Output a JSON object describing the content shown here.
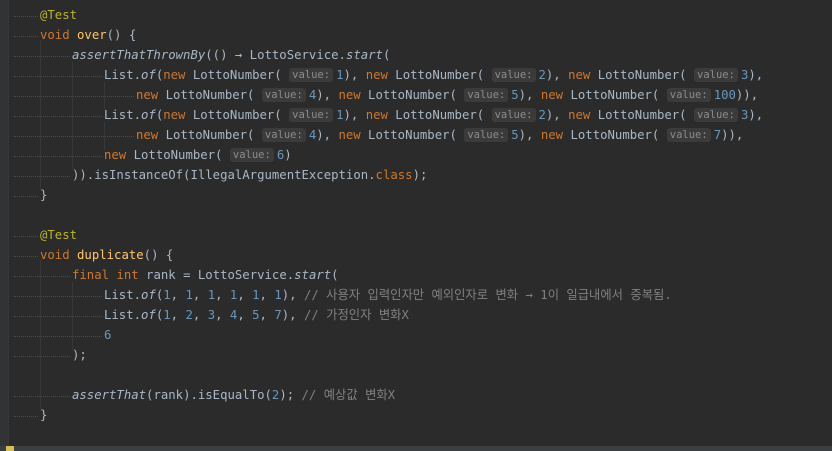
{
  "editor": {
    "lines": [
      [
        {
          "t": "@Test",
          "c": "annotation"
        }
      ],
      [
        {
          "t": "void",
          "c": "keyword"
        },
        {
          "t": " ",
          "c": "plain"
        },
        {
          "t": "over",
          "c": "method"
        },
        {
          "t": "() {",
          "c": "plain"
        }
      ],
      [
        {
          "t": "assertThatThrownBy",
          "c": "static"
        },
        {
          "t": "(() → LottoService.",
          "c": "plain"
        },
        {
          "t": "start",
          "c": "static"
        },
        {
          "t": "(",
          "c": "plain"
        }
      ],
      [
        {
          "t": "List.",
          "c": "plain"
        },
        {
          "t": "of",
          "c": "static"
        },
        {
          "t": "(",
          "c": "plain"
        },
        {
          "t": "new",
          "c": "keyword"
        },
        {
          "t": " LottoNumber( ",
          "c": "plain"
        },
        {
          "h": "value:"
        },
        {
          "t": "1",
          "c": "number"
        },
        {
          "t": "), ",
          "c": "plain"
        },
        {
          "t": "new",
          "c": "keyword"
        },
        {
          "t": " LottoNumber( ",
          "c": "plain"
        },
        {
          "h": "value:"
        },
        {
          "t": "2",
          "c": "number"
        },
        {
          "t": "), ",
          "c": "plain"
        },
        {
          "t": "new",
          "c": "keyword"
        },
        {
          "t": " LottoNumber( ",
          "c": "plain"
        },
        {
          "h": "value:"
        },
        {
          "t": "3",
          "c": "number"
        },
        {
          "t": "),",
          "c": "plain"
        }
      ],
      [
        {
          "t": "new",
          "c": "keyword"
        },
        {
          "t": " LottoNumber( ",
          "c": "plain"
        },
        {
          "h": "value:"
        },
        {
          "t": "4",
          "c": "number"
        },
        {
          "t": "), ",
          "c": "plain"
        },
        {
          "t": "new",
          "c": "keyword"
        },
        {
          "t": " LottoNumber( ",
          "c": "plain"
        },
        {
          "h": "value:"
        },
        {
          "t": "5",
          "c": "number"
        },
        {
          "t": "), ",
          "c": "plain"
        },
        {
          "t": "new",
          "c": "keyword"
        },
        {
          "t": " LottoNumber( ",
          "c": "plain"
        },
        {
          "h": "value:"
        },
        {
          "t": "100",
          "c": "number"
        },
        {
          "t": ")),",
          "c": "plain"
        }
      ],
      [
        {
          "t": "List.",
          "c": "plain"
        },
        {
          "t": "of",
          "c": "static"
        },
        {
          "t": "(",
          "c": "plain"
        },
        {
          "t": "new",
          "c": "keyword"
        },
        {
          "t": " LottoNumber( ",
          "c": "plain"
        },
        {
          "h": "value:"
        },
        {
          "t": "1",
          "c": "number"
        },
        {
          "t": "), ",
          "c": "plain"
        },
        {
          "t": "new",
          "c": "keyword"
        },
        {
          "t": " LottoNumber( ",
          "c": "plain"
        },
        {
          "h": "value:"
        },
        {
          "t": "2",
          "c": "number"
        },
        {
          "t": "), ",
          "c": "plain"
        },
        {
          "t": "new",
          "c": "keyword"
        },
        {
          "t": " LottoNumber( ",
          "c": "plain"
        },
        {
          "h": "value:"
        },
        {
          "t": "3",
          "c": "number"
        },
        {
          "t": "),",
          "c": "plain"
        }
      ],
      [
        {
          "t": "new",
          "c": "keyword"
        },
        {
          "t": " LottoNumber( ",
          "c": "plain"
        },
        {
          "h": "value:"
        },
        {
          "t": "4",
          "c": "number"
        },
        {
          "t": "), ",
          "c": "plain"
        },
        {
          "t": "new",
          "c": "keyword"
        },
        {
          "t": " LottoNumber( ",
          "c": "plain"
        },
        {
          "h": "value:"
        },
        {
          "t": "5",
          "c": "number"
        },
        {
          "t": "), ",
          "c": "plain"
        },
        {
          "t": "new",
          "c": "keyword"
        },
        {
          "t": " LottoNumber( ",
          "c": "plain"
        },
        {
          "h": "value:"
        },
        {
          "t": "7",
          "c": "number"
        },
        {
          "t": ")),",
          "c": "plain"
        }
      ],
      [
        {
          "t": "new",
          "c": "keyword"
        },
        {
          "t": " LottoNumber( ",
          "c": "plain"
        },
        {
          "h": "value:"
        },
        {
          "t": "6",
          "c": "number"
        },
        {
          "t": ")",
          "c": "plain"
        }
      ],
      [
        {
          "t": ")).isInstanceOf(IllegalArgumentException.",
          "c": "plain"
        },
        {
          "t": "class",
          "c": "keyword"
        },
        {
          "t": ");",
          "c": "plain"
        }
      ],
      [
        {
          "t": "}",
          "c": "plain"
        }
      ],
      [],
      [
        {
          "t": "@Test",
          "c": "annotation"
        }
      ],
      [
        {
          "t": "void",
          "c": "keyword"
        },
        {
          "t": " ",
          "c": "plain"
        },
        {
          "t": "duplicate",
          "c": "method"
        },
        {
          "t": "() {",
          "c": "plain"
        }
      ],
      [
        {
          "t": "final",
          "c": "keyword"
        },
        {
          "t": " ",
          "c": "plain"
        },
        {
          "t": "int",
          "c": "keyword"
        },
        {
          "t": " rank = LottoService.",
          "c": "plain"
        },
        {
          "t": "start",
          "c": "static"
        },
        {
          "t": "(",
          "c": "plain"
        }
      ],
      [
        {
          "t": "List.",
          "c": "plain"
        },
        {
          "t": "of",
          "c": "static"
        },
        {
          "t": "(",
          "c": "plain"
        },
        {
          "t": "1",
          "c": "number"
        },
        {
          "t": ", ",
          "c": "plain"
        },
        {
          "t": "1",
          "c": "number"
        },
        {
          "t": ", ",
          "c": "plain"
        },
        {
          "t": "1",
          "c": "number"
        },
        {
          "t": ", ",
          "c": "plain"
        },
        {
          "t": "1",
          "c": "number"
        },
        {
          "t": ", ",
          "c": "plain"
        },
        {
          "t": "1",
          "c": "number"
        },
        {
          "t": ", ",
          "c": "plain"
        },
        {
          "t": "1",
          "c": "number"
        },
        {
          "t": "), ",
          "c": "plain"
        },
        {
          "t": "// 사용자 입력인자만 예외인자로 변화 → 1이 일급내에서 중복됨.",
          "c": "comment"
        }
      ],
      [
        {
          "t": "List.",
          "c": "plain"
        },
        {
          "t": "of",
          "c": "static"
        },
        {
          "t": "(",
          "c": "plain"
        },
        {
          "t": "1",
          "c": "number"
        },
        {
          "t": ", ",
          "c": "plain"
        },
        {
          "t": "2",
          "c": "number"
        },
        {
          "t": ", ",
          "c": "plain"
        },
        {
          "t": "3",
          "c": "number"
        },
        {
          "t": ", ",
          "c": "plain"
        },
        {
          "t": "4",
          "c": "number"
        },
        {
          "t": ", ",
          "c": "plain"
        },
        {
          "t": "5",
          "c": "number"
        },
        {
          "t": ", ",
          "c": "plain"
        },
        {
          "t": "7",
          "c": "number"
        },
        {
          "t": "), ",
          "c": "plain"
        },
        {
          "t": "// 가정인자 변화X",
          "c": "comment"
        }
      ],
      [
        {
          "t": "6",
          "c": "number"
        }
      ],
      [
        {
          "t": ");",
          "c": "plain"
        }
      ],
      [],
      [
        {
          "t": "assertThat",
          "c": "static"
        },
        {
          "t": "(rank).isEqualTo(",
          "c": "plain"
        },
        {
          "t": "2",
          "c": "number"
        },
        {
          "t": "); ",
          "c": "plain"
        },
        {
          "t": "// 예상값 변화X",
          "c": "comment"
        }
      ],
      [
        {
          "t": "}",
          "c": "plain"
        }
      ]
    ]
  }
}
